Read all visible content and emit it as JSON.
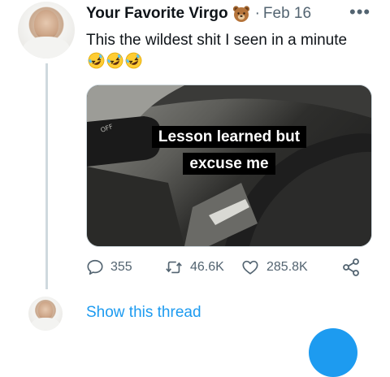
{
  "tweet": {
    "author_name": "Your Favorite Virgo",
    "author_emoji": "bear-face-icon",
    "separator": "·",
    "date": "Feb 16",
    "more_label": "•••",
    "text": "This the wildest shit I seen in a minute",
    "text_emojis": [
      "rolling-on-floor-laughing-icon",
      "rolling-on-floor-laughing-icon",
      "rolling-on-floor-laughing-icon"
    ],
    "media": {
      "caption_line1": "Lesson learned but",
      "caption_line2": "excuse me"
    },
    "actions": {
      "replies": "355",
      "retweets": "46.6K",
      "likes": "285.8K"
    }
  },
  "thread": {
    "show_thread_label": "Show this thread"
  },
  "colors": {
    "accent": "#1d9bf0",
    "secondary_text": "#536471",
    "thread_line": "#cfd9de"
  }
}
